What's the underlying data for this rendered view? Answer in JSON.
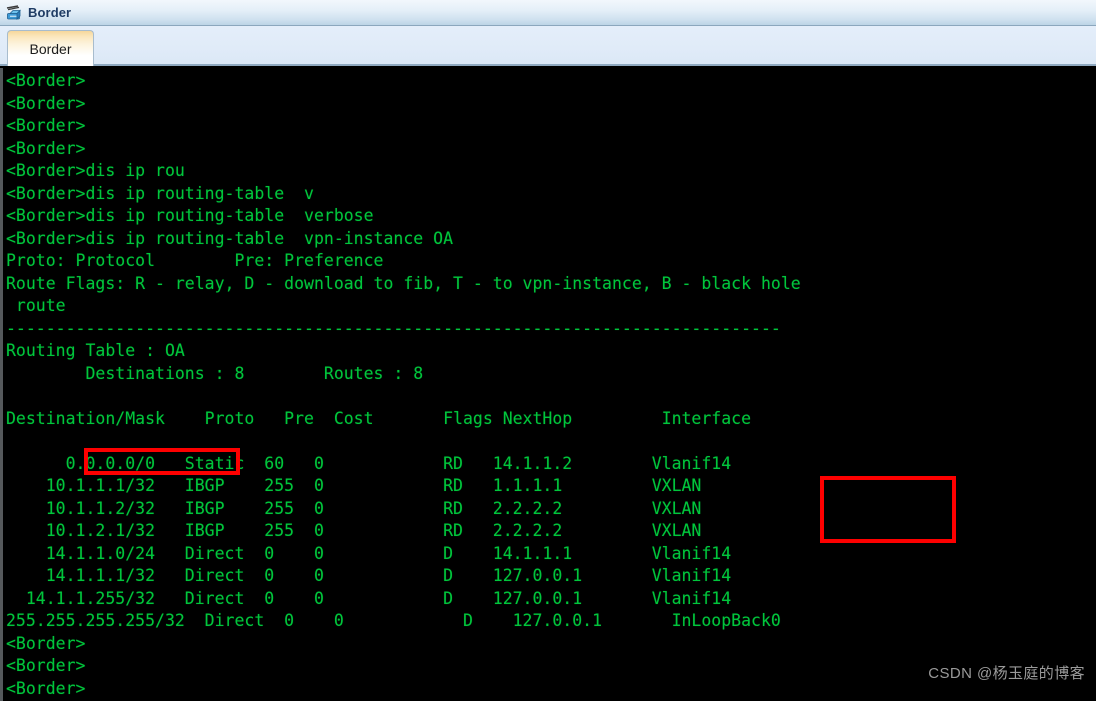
{
  "window": {
    "title": "Border",
    "icon": "router-device-icon"
  },
  "tabs": [
    {
      "label": "Border",
      "active": true
    }
  ],
  "terminal": {
    "prompt": "<Border>",
    "text_color": "#00c63c",
    "background_color": "#000000",
    "lines": [
      "<Border>",
      "<Border>",
      "<Border>",
      "<Border>",
      "<Border>dis ip rou",
      "<Border>dis ip routing-table  v",
      "<Border>dis ip routing-table  verbose",
      "<Border>dis ip routing-table  vpn-instance OA",
      "Proto: Protocol        Pre: Preference",
      "Route Flags: R - relay, D - download to fib, T - to vpn-instance, B - black hole",
      " route",
      "------------------------------------------------------------------------------",
      "Routing Table : OA",
      "        Destinations : 8        Routes : 8",
      "",
      "Destination/Mask    Proto   Pre  Cost       Flags NextHop         Interface",
      "",
      "      0.0.0.0/0   Static  60   0            RD   14.1.1.2        Vlanif14",
      "    10.1.1.1/32   IBGP    255  0            RD   1.1.1.1         VXLAN",
      "    10.1.1.2/32   IBGP    255  0            RD   2.2.2.2         VXLAN",
      "    10.1.2.1/32   IBGP    255  0            RD   2.2.2.2         VXLAN",
      "    14.1.1.0/24   Direct  0    0            D    14.1.1.1        Vlanif14",
      "    14.1.1.1/32   Direct  0    0            D    127.0.0.1       Vlanif14",
      "  14.1.1.255/32   Direct  0    0            D    127.0.0.1       Vlanif14",
      "255.255.255.255/32  Direct  0    0            D    127.0.0.1       InLoopBack0",
      "<Border>",
      "<Border>",
      "<Border>"
    ],
    "routing_table": {
      "name": "OA",
      "destinations": "8",
      "routes": "8",
      "legend": {
        "proto": "Proto: Protocol",
        "pre": "Pre: Preference",
        "flags": "Route Flags: R - relay, D - download to fib, T - to vpn-instance, B - black hole route"
      },
      "columns": [
        "Destination/Mask",
        "Proto",
        "Pre",
        "Cost",
        "Flags",
        "NextHop",
        "Interface"
      ],
      "rows": [
        {
          "destination": "0.0.0.0/0",
          "proto": "Static",
          "pre": "60",
          "cost": "0",
          "flags": "RD",
          "nexthop": "14.1.1.2",
          "interface": "Vlanif14"
        },
        {
          "destination": "10.1.1.1/32",
          "proto": "IBGP",
          "pre": "255",
          "cost": "0",
          "flags": "RD",
          "nexthop": "1.1.1.1",
          "interface": "VXLAN"
        },
        {
          "destination": "10.1.1.2/32",
          "proto": "IBGP",
          "pre": "255",
          "cost": "0",
          "flags": "RD",
          "nexthop": "2.2.2.2",
          "interface": "VXLAN"
        },
        {
          "destination": "10.1.2.1/32",
          "proto": "IBGP",
          "pre": "255",
          "cost": "0",
          "flags": "RD",
          "nexthop": "2.2.2.2",
          "interface": "VXLAN"
        },
        {
          "destination": "14.1.1.0/24",
          "proto": "Direct",
          "pre": "0",
          "cost": "0",
          "flags": "D",
          "nexthop": "14.1.1.1",
          "interface": "Vlanif14"
        },
        {
          "destination": "14.1.1.1/32",
          "proto": "Direct",
          "pre": "0",
          "cost": "0",
          "flags": "D",
          "nexthop": "127.0.0.1",
          "interface": "Vlanif14"
        },
        {
          "destination": "14.1.1.255/32",
          "proto": "Direct",
          "pre": "0",
          "cost": "0",
          "flags": "D",
          "nexthop": "127.0.0.1",
          "interface": "Vlanif14"
        },
        {
          "destination": "255.255.255.255/32",
          "proto": "Direct",
          "pre": "0",
          "cost": "0",
          "flags": "D",
          "nexthop": "127.0.0.1",
          "interface": "InLoopBack0"
        }
      ]
    },
    "commands_entered": [
      "dis ip rou",
      "dis ip routing-table  v",
      "dis ip routing-table  verbose",
      "dis ip routing-table  vpn-instance OA"
    ]
  },
  "annotations": {
    "color": "#fe0000",
    "boxes": [
      {
        "name": "default-route",
        "target": "0.0.0.0/0"
      },
      {
        "name": "vxlan-interfaces",
        "target": "VXLAN"
      }
    ]
  },
  "watermark": {
    "text": "CSDN @杨玉庭的博客",
    "color": "#9a9a9a"
  }
}
